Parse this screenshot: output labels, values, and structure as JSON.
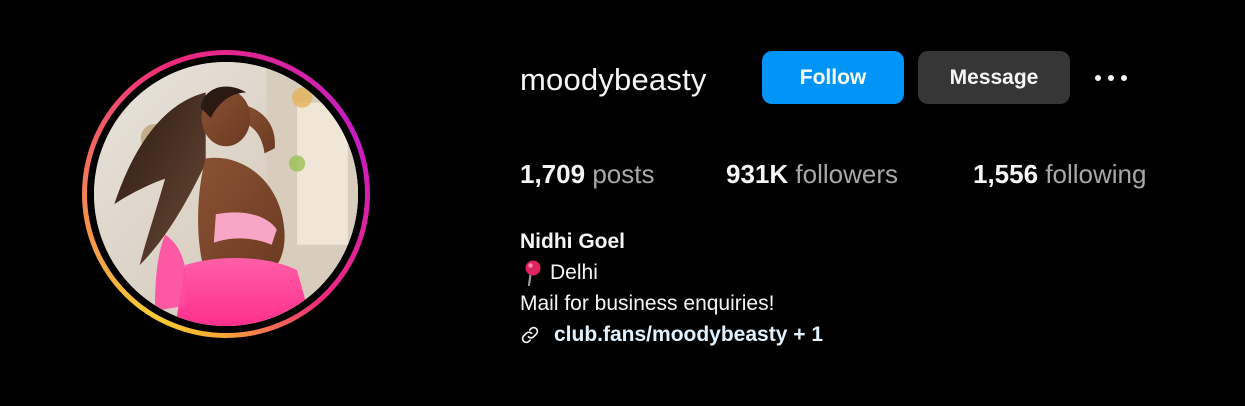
{
  "profile": {
    "username": "moodybeasty",
    "full_name": "Nidhi Goel",
    "location": "Delhi",
    "bio_line": "Mail for business enquiries!",
    "link": "club.fans/moodybeasty + 1",
    "location_icon": "map-pin-icon",
    "link_icon": "link-icon",
    "avatar_alt": "profile picture"
  },
  "actions": {
    "follow_label": "Follow",
    "message_label": "Message",
    "more_icon": "more-options-icon"
  },
  "stats": {
    "posts_count": "1,709",
    "posts_label": "posts",
    "followers_count": "931K",
    "followers_label": "followers",
    "following_count": "1,556",
    "following_label": "following"
  },
  "colors": {
    "background": "#000000",
    "follow_button": "#0095f6",
    "message_button": "#363636",
    "text_primary": "#f5f5f5",
    "text_secondary": "#a8a8a8"
  }
}
